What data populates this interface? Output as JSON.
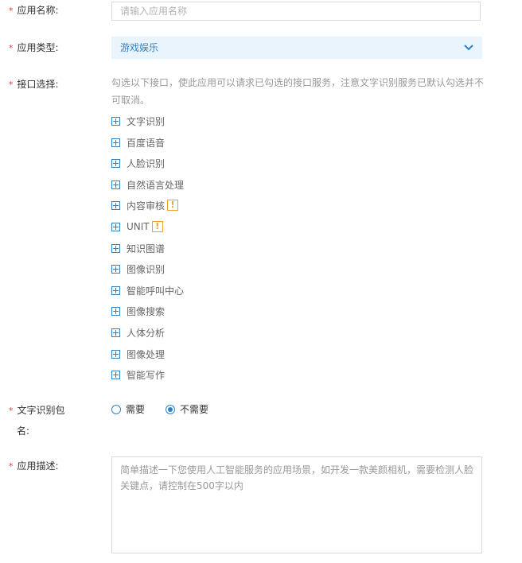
{
  "form": {
    "app_name": {
      "required_mark": "*",
      "label": "应用名称:",
      "placeholder": "请输入应用名称",
      "value": ""
    },
    "app_type": {
      "required_mark": "*",
      "label": "应用类型:",
      "selected": "游戏娱乐",
      "icon": "chevron-down-icon"
    },
    "api_select": {
      "required_mark": "*",
      "label": "接口选择:",
      "hint": "勾选以下接口，使此应用可以请求已勾选的接口服务，注意文字识别服务已默认勾选并不可取消。",
      "items": [
        {
          "label": "文字识别",
          "warn": ""
        },
        {
          "label": "百度语音",
          "warn": ""
        },
        {
          "label": "人脸识别",
          "warn": ""
        },
        {
          "label": "自然语言处理",
          "warn": ""
        },
        {
          "label": "内容审核",
          "warn": "!"
        },
        {
          "label": "UNIT",
          "warn": "!"
        },
        {
          "label": "知识图谱",
          "warn": ""
        },
        {
          "label": "图像识别",
          "warn": ""
        },
        {
          "label": "智能呼叫中心",
          "warn": ""
        },
        {
          "label": "图像搜索",
          "warn": ""
        },
        {
          "label": "人体分析",
          "warn": ""
        },
        {
          "label": "图像处理",
          "warn": ""
        },
        {
          "label": "智能写作",
          "warn": ""
        }
      ],
      "accent_color": "#2e82c8",
      "warn_color": "#f0a031"
    },
    "ocr_package": {
      "required_mark": "*",
      "label_line1": "文字识别包",
      "label_line2": "名:",
      "options": [
        {
          "label": "需要",
          "checked": false
        },
        {
          "label": "不需要",
          "checked": true
        }
      ]
    },
    "app_desc": {
      "required_mark": "*",
      "label": "应用描述:",
      "placeholder": "简单描述一下您使用人工智能服务的应用场景，如开发一款美颜相机，需要检测人脸关键点，请控制在500字以内",
      "value": ""
    }
  }
}
